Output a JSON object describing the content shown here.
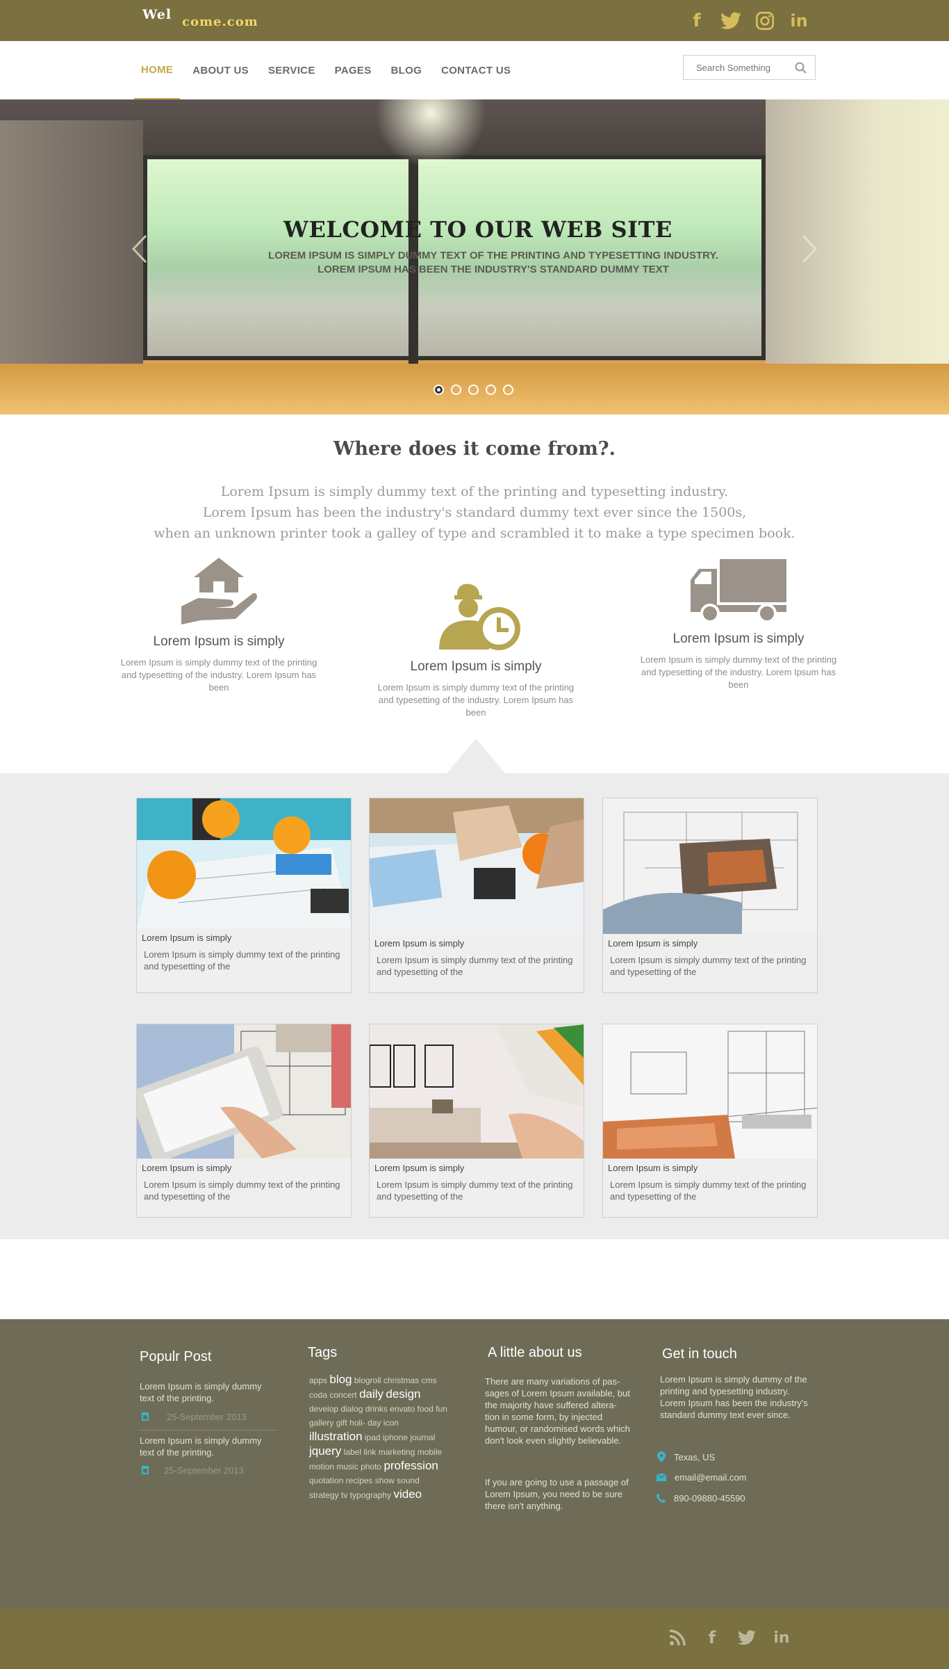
{
  "header": {
    "logo_part1": "Wel",
    "logo_part2": "come.com",
    "social": [
      "facebook-icon",
      "twitter-icon",
      "instagram-icon",
      "linkedin-icon"
    ]
  },
  "nav": {
    "items": [
      {
        "label": "HOME",
        "active": true
      },
      {
        "label": "ABOUT US",
        "active": false
      },
      {
        "label": "SERVICE",
        "active": false
      },
      {
        "label": "PAGES",
        "active": false
      },
      {
        "label": "BLOG",
        "active": false
      },
      {
        "label": "CONTACT US",
        "active": false
      }
    ],
    "search_placeholder": "Search Something"
  },
  "hero": {
    "title": "WELCOME TO OUR WEB SITE",
    "subtitle": "LOREM IPSUM IS SIMPLY DUMMY TEXT OF THE PRINTING AND TYPESETTING INDUSTRY. LOREM IPSUM HAS BEEN THE INDUSTRY'S STANDARD DUMMY TEXT",
    "slide_count": 5,
    "active_slide": 1
  },
  "intro": {
    "title": "Where does it come from?.",
    "line1": "Lorem Ipsum is simply dummy text of the printing and typesetting industry.",
    "line2": "Lorem Ipsum has been the industry's standard dummy text ever since the 1500s,",
    "line3": "when an unknown printer took a galley of type and scrambled it to make a type specimen book."
  },
  "features": [
    {
      "icon": "hand-house-icon",
      "title": "Lorem Ipsum is simply",
      "text": "Lorem Ipsum is simply dummy text of the printing and typesetting of the industry. Lorem Ipsum has been"
    },
    {
      "icon": "worker-clock-icon",
      "title": "Lorem Ipsum is simply",
      "text": "Lorem Ipsum is simply dummy text of the printing and typesetting of the industry. Lorem Ipsum has been"
    },
    {
      "icon": "truck-icon",
      "title": "Lorem Ipsum is simply",
      "text": "Lorem Ipsum is simply dummy text of the printing and typesetting of the industry. Lorem Ipsum has been"
    }
  ],
  "gallery": [
    {
      "title": "Lorem Ipsum is simply",
      "text": "Lorem Ipsum is simply dummy text of the printing and typesetting of the"
    },
    {
      "title": "Lorem Ipsum is simply",
      "text": "Lorem Ipsum is simply dummy text of the printing and typesetting of the"
    },
    {
      "title": "Lorem Ipsum is simply",
      "text": "Lorem Ipsum is simply dummy text of the printing and typesetting of the"
    },
    {
      "title": "Lorem Ipsum is simply",
      "text": "Lorem Ipsum is simply dummy text of the printing and typesetting of the"
    },
    {
      "title": "Lorem Ipsum is simply",
      "text": "Lorem Ipsum is simply dummy text of the printing and typesetting of the"
    },
    {
      "title": "Lorem Ipsum is simply",
      "text": "Lorem Ipsum is simply dummy text of the printing and typesetting of the"
    }
  ],
  "footer": {
    "popular": {
      "title": "Populr Post",
      "posts": [
        {
          "text": "Lorem Ipsum is simply dummy text of the printing.",
          "date": "25-September 2013"
        },
        {
          "text": "Lorem Ipsum is simply dummy text of the printing.",
          "date": "25-September 2013"
        }
      ]
    },
    "tags": {
      "title": "Tags",
      "items": [
        {
          "t": "apps",
          "big": false
        },
        {
          "t": "blog",
          "big": true
        },
        {
          "t": "blogroll",
          "big": false
        },
        {
          "t": "christmas",
          "big": false
        },
        {
          "t": "cms",
          "big": false
        },
        {
          "t": "coda",
          "big": false
        },
        {
          "t": "concert",
          "big": false
        },
        {
          "t": "daily",
          "big": true
        },
        {
          "t": "design",
          "big": true
        },
        {
          "t": "develop",
          "big": false
        },
        {
          "t": "dialog",
          "big": false
        },
        {
          "t": "drinks",
          "big": false
        },
        {
          "t": "envato",
          "big": false
        },
        {
          "t": "food",
          "big": false
        },
        {
          "t": "fun",
          "big": false
        },
        {
          "t": "gallery",
          "big": false
        },
        {
          "t": "gift",
          "big": false
        },
        {
          "t": "holi-",
          "big": false
        },
        {
          "t": "day",
          "big": false
        },
        {
          "t": "icon",
          "big": false
        },
        {
          "t": "illustration",
          "big": true
        },
        {
          "t": "ipad",
          "big": false
        },
        {
          "t": "iphone",
          "big": false
        },
        {
          "t": "journal",
          "big": false
        },
        {
          "t": "jquery",
          "big": true
        },
        {
          "t": "label",
          "big": false
        },
        {
          "t": "link",
          "big": false
        },
        {
          "t": "marketing",
          "big": false
        },
        {
          "t": "mobile",
          "big": false
        },
        {
          "t": "motion",
          "big": false
        },
        {
          "t": "music",
          "big": false
        },
        {
          "t": "photo",
          "big": false
        },
        {
          "t": "profession",
          "big": true
        },
        {
          "t": "quotation",
          "big": false
        },
        {
          "t": "recipes",
          "big": false
        },
        {
          "t": "show",
          "big": false
        },
        {
          "t": "sound",
          "big": false
        },
        {
          "t": "strategy",
          "big": false
        },
        {
          "t": "tv",
          "big": false
        },
        {
          "t": "typography",
          "big": false
        },
        {
          "t": "video",
          "big": true
        }
      ]
    },
    "about": {
      "title": "A little about us",
      "p1": "There are many variations of pas-sages of Lorem Ipsum available, but the majority have suffered altera-tion in some form, by injected humour, or randomised words which don't look even slightly believable.",
      "p2": "If you are going to use a passage of Lorem Ipsum, you need to be sure there isn't anything."
    },
    "contact": {
      "title": "Get in touch",
      "text": "Lorem Ipsum is simply dummy of the printing and typesetting industry. Lorem Ipsum has been the industry's standard dummy text ever since.",
      "location": "Texas, US",
      "email": "email@email.com",
      "phone": "890-09880-45590"
    },
    "social": [
      "rss-icon",
      "facebook-icon",
      "twitter-icon",
      "linkedin-icon"
    ]
  },
  "colors": {
    "brand": "#7a7040",
    "accent": "#c7a74b",
    "footer": "#6e6c57",
    "contact_icon": "#36b7c9"
  }
}
